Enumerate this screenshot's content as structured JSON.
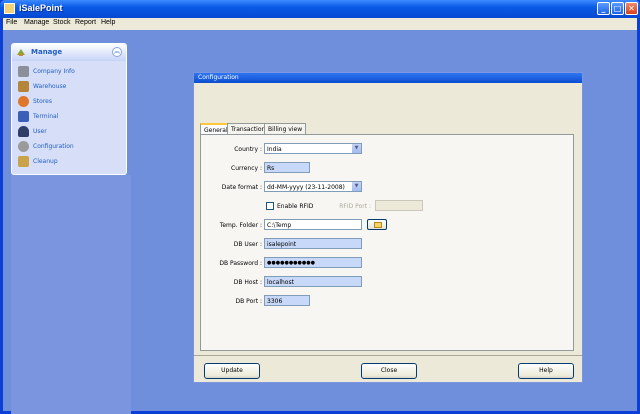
{
  "window": {
    "title": "iSalePoint"
  },
  "menu": {
    "file": "File",
    "manage": "Manage",
    "stock": "Stock",
    "report": "Report",
    "help": "Help"
  },
  "task_panel": {
    "title": "Manage",
    "items": [
      {
        "label": "Company Info",
        "icon": "company-icon"
      },
      {
        "label": "Warehouse",
        "icon": "warehouse-icon"
      },
      {
        "label": "Stores",
        "icon": "stores-icon"
      },
      {
        "label": "Terminal",
        "icon": "terminal-icon"
      },
      {
        "label": "User",
        "icon": "user-icon"
      },
      {
        "label": "Configuration",
        "icon": "configuration-icon"
      },
      {
        "label": "Cleanup",
        "icon": "cleanup-icon"
      }
    ]
  },
  "dialog": {
    "title": "Configuration",
    "tabs": [
      "General",
      "Transaction",
      "Billing view"
    ],
    "fields": {
      "country_label": "Country :",
      "country_value": "India",
      "currency_label": "Currency :",
      "currency_value": "Rs",
      "date_format_label": "Date format :",
      "date_format_value": "dd-MM-yyyy (23-11-2008)",
      "enable_rfid_label": "Enable RFID",
      "rfid_port_label": "RFID Port :",
      "rfid_port_value": "",
      "temp_folder_label": "Temp. Folder :",
      "temp_folder_value": "C:\\Temp",
      "db_user_label": "DB User :",
      "db_user_value": "isalepoint",
      "db_password_label": "DB Password :",
      "db_password_value": "●●●●●●●●●●●",
      "db_host_label": "DB Host :",
      "db_host_value": "localhost",
      "db_port_label": "DB Port :",
      "db_port_value": "3306"
    },
    "buttons": {
      "update": "Update",
      "close": "Close",
      "help": "Help"
    }
  }
}
